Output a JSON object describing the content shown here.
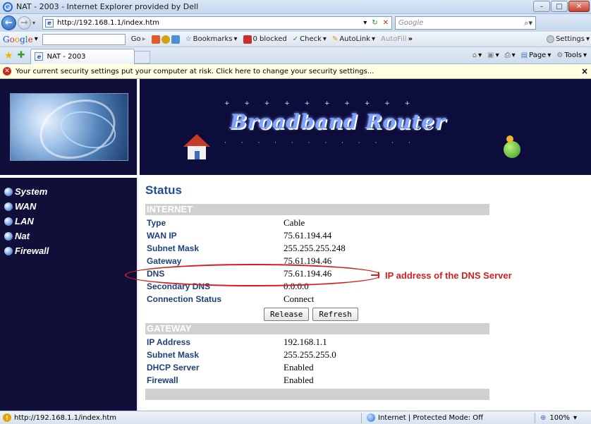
{
  "window": {
    "title": "NAT - 2003 - Internet Explorer provided by Dell"
  },
  "address_bar": {
    "url": "http://192.168.1.1/index.htm",
    "search_placeholder": "Google"
  },
  "google_toolbar": {
    "logo": [
      "G",
      "o",
      "o",
      "g",
      "l",
      "e"
    ],
    "go_label": "Go",
    "bookmarks_label": "Bookmarks",
    "blocked_label": "0 blocked",
    "check_label": "Check",
    "autolink_label": "AutoLink",
    "autofill_label": "AutoFill",
    "more_label": "»",
    "settings_label": "Settings"
  },
  "tabs": [
    {
      "label": "NAT - 2003"
    }
  ],
  "command_bar": {
    "page_label": "Page",
    "tools_label": "Tools"
  },
  "info_bar": {
    "message": "Your current security settings put your computer at risk. Click here to change your security settings..."
  },
  "banner": {
    "title": "Broadband Router"
  },
  "sidebar": {
    "items": [
      {
        "label": "System"
      },
      {
        "label": "WAN"
      },
      {
        "label": "LAN"
      },
      {
        "label": "Nat"
      },
      {
        "label": "Firewall"
      }
    ]
  },
  "status_page": {
    "title": "Status",
    "internet": {
      "header": "INTERNET",
      "rows": [
        {
          "label": "Type",
          "value": "Cable"
        },
        {
          "label": "WAN IP",
          "value": "75.61.194.44"
        },
        {
          "label": "Subnet Mask",
          "value": "255.255.255.248"
        },
        {
          "label": "Gateway",
          "value": "75.61.194.46"
        },
        {
          "label": "DNS",
          "value": "75.61.194.46"
        },
        {
          "label": "Secondary DNS",
          "value": "0.0.0.0"
        },
        {
          "label": "Connection Status",
          "value": "Connect"
        }
      ],
      "release_label": "Release",
      "refresh_label": "Refresh"
    },
    "gateway": {
      "header": "GATEWAY",
      "rows": [
        {
          "label": "IP Address",
          "value": "192.168.1.1"
        },
        {
          "label": "Subnet Mask",
          "value": "255.255.255.0"
        },
        {
          "label": "DHCP Server",
          "value": "Enabled"
        },
        {
          "label": "Firewall",
          "value": "Enabled"
        }
      ]
    }
  },
  "annotation": {
    "label": "IP address of the DNS Server",
    "color": "#d41e1e"
  },
  "status_bar": {
    "url": "http://192.168.1.1/index.htm",
    "zone": "Internet | Protected Mode: Off",
    "zoom": "100%"
  },
  "colors": {
    "nav_bg": "#0f0f3a",
    "status_title": "#1f4e94",
    "label_color": "#1f3f7a",
    "section_header_bg": "#cfd0d2"
  }
}
